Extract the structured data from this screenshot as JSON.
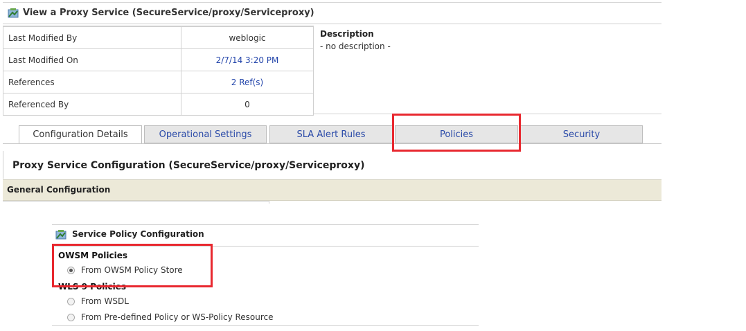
{
  "header": {
    "title": "View a Proxy Service (SecureService/proxy/Serviceproxy)",
    "icon": "proxy-service-icon"
  },
  "properties": [
    {
      "label": "Last Modified By",
      "value": "weblogic",
      "link": false
    },
    {
      "label": "Last Modified On",
      "value": "2/7/14 3:20 PM",
      "link": true
    },
    {
      "label": "References",
      "value": "2 Ref(s)",
      "link": true
    },
    {
      "label": "Referenced By",
      "value": "0",
      "link": false
    }
  ],
  "description": {
    "heading": "Description",
    "text": "- no description -"
  },
  "tabs": [
    {
      "label": "Configuration Details",
      "active": true
    },
    {
      "label": "Operational Settings",
      "active": false
    },
    {
      "label": "SLA Alert Rules",
      "active": false
    },
    {
      "label": "Policies",
      "active": false
    },
    {
      "label": "Security",
      "active": false
    }
  ],
  "config": {
    "title": "Proxy Service Configuration (SecureService/proxy/Serviceproxy)",
    "general": "General Configuration"
  },
  "service_policy": {
    "title": "Service Policy Configuration",
    "icon": "policy-config-icon",
    "owsm_heading": "OWSM Policies",
    "owsm_option": "From OWSM Policy Store",
    "wls_heading": "WLS 9 Policies",
    "wls_options": [
      "From WSDL",
      "From Pre-defined Policy or WS-Policy Resource"
    ]
  },
  "colors": {
    "highlight": "#e8282f",
    "link": "#2244aa",
    "section_bar": "#ece9d8"
  }
}
